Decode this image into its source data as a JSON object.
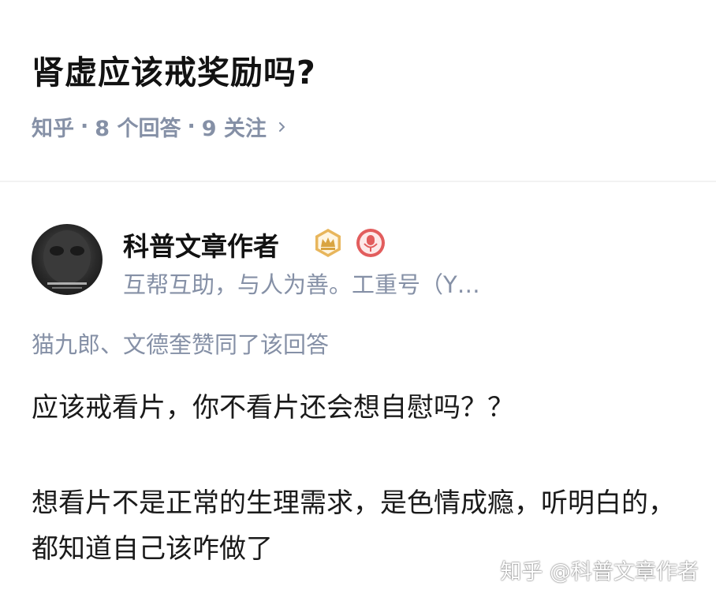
{
  "question": {
    "title": "肾虚应该戒奖励吗?",
    "meta": {
      "site": "知乎",
      "answers": "8 个回答",
      "followers": "9 关注"
    }
  },
  "answer": {
    "author": {
      "name": "科普文章作者",
      "bio": "互帮互助，与人为善。工重号（Y…",
      "badges": [
        "crown-badge-icon",
        "mic-badge-icon"
      ]
    },
    "voters": "猫九郎、文德奎赞同了该回答",
    "paragraphs": [
      "应该戒看片，你不看片还会想自慰吗？？",
      "想看片不是正常的生理需求，是色情成瘾，听明白的，都知道自己该咋做了"
    ]
  },
  "watermark": "知乎 @科普文章作者",
  "colors": {
    "meta_gray": "#8590a6",
    "crown_gold": "#d9a441",
    "badge_red": "#e25d5d"
  }
}
